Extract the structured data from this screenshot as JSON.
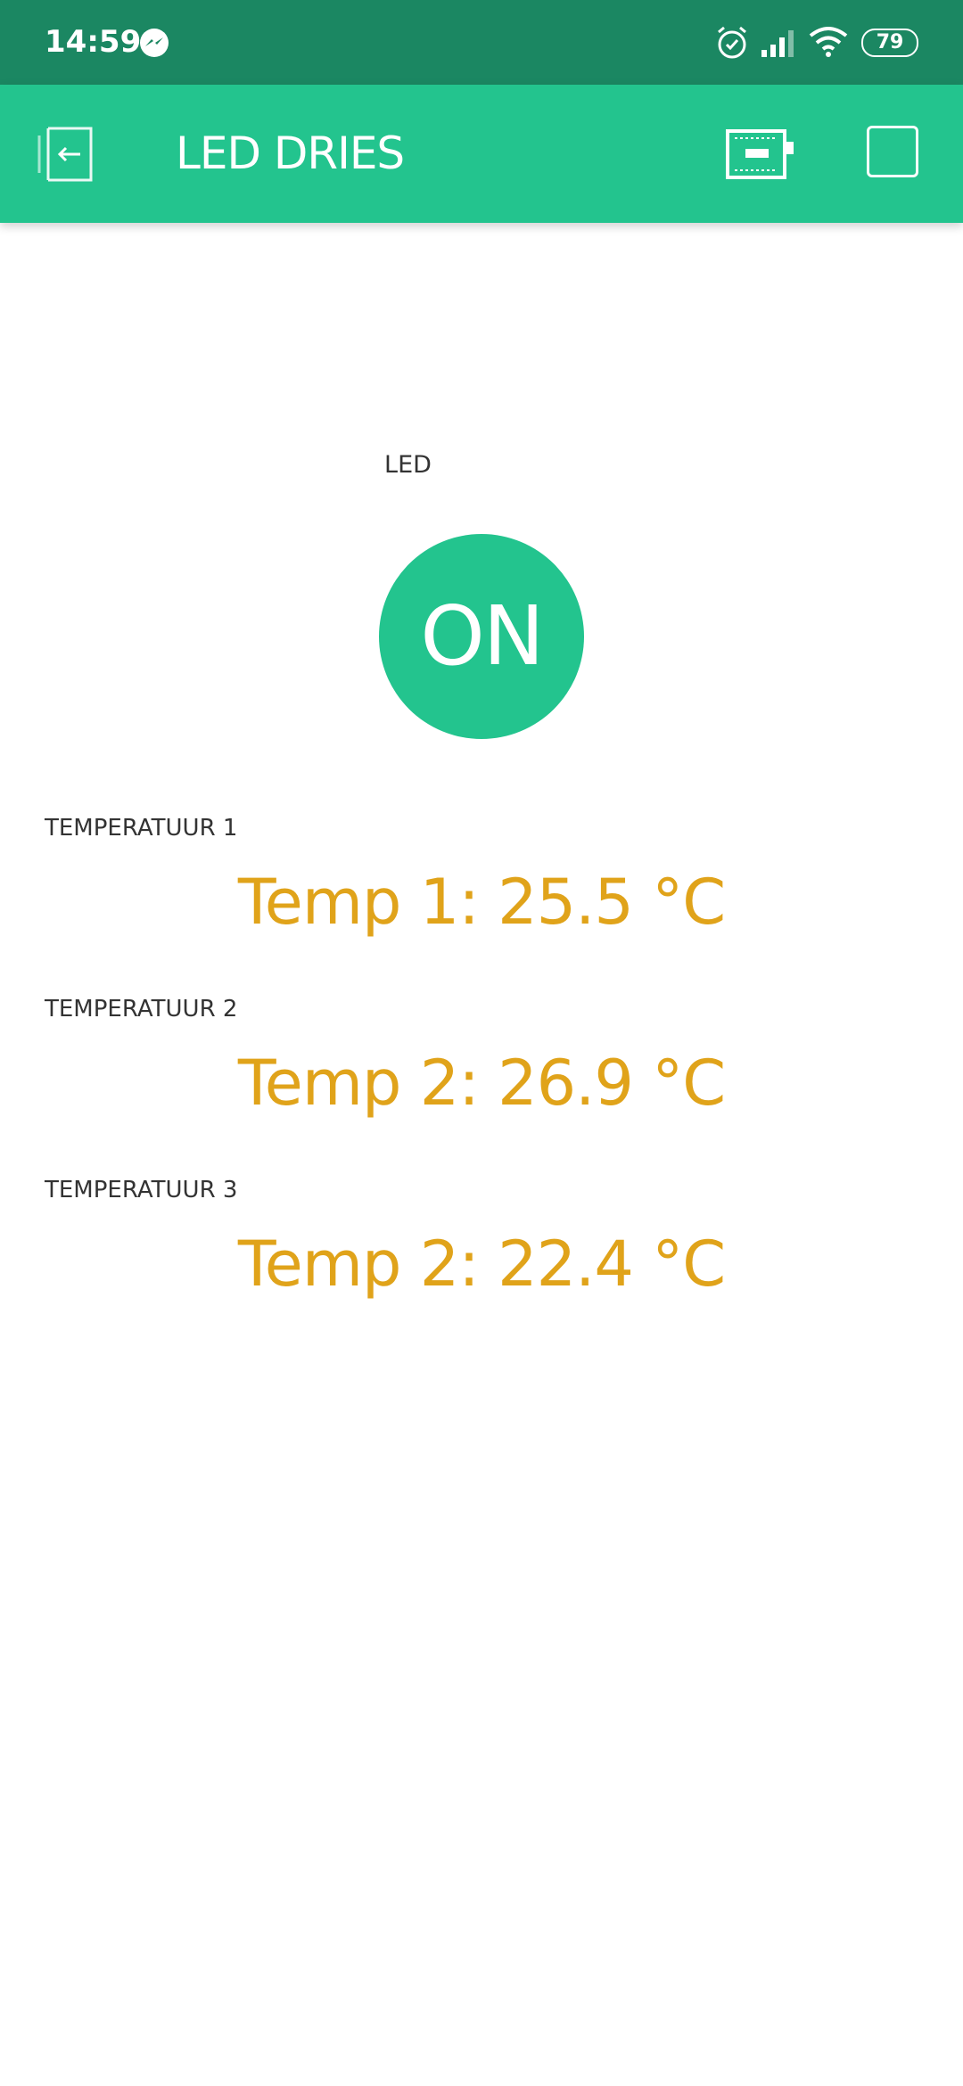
{
  "status_bar": {
    "time": "14:59",
    "battery": "79",
    "icons": [
      "messenger-icon",
      "alarm-icon",
      "signal-icon",
      "wifi-icon",
      "battery-icon"
    ]
  },
  "app_bar": {
    "title": "LED DRIES",
    "icons": [
      "back-icon",
      "device-board-icon",
      "add-widget-icon"
    ],
    "color": "#23c48e"
  },
  "led_widget": {
    "label": "LED",
    "button_label": "ON",
    "color": "#23c48e"
  },
  "temperature_widgets": [
    {
      "label": "TEMPERATUUR 1",
      "value": "Temp 1: 25.5 °C"
    },
    {
      "label": "TEMPERATUUR 2",
      "value": "Temp 2: 26.9 °C"
    },
    {
      "label": "TEMPERATUUR 3",
      "value": "Temp 2: 22.4 °C"
    }
  ],
  "value_color": "#e0a31a"
}
